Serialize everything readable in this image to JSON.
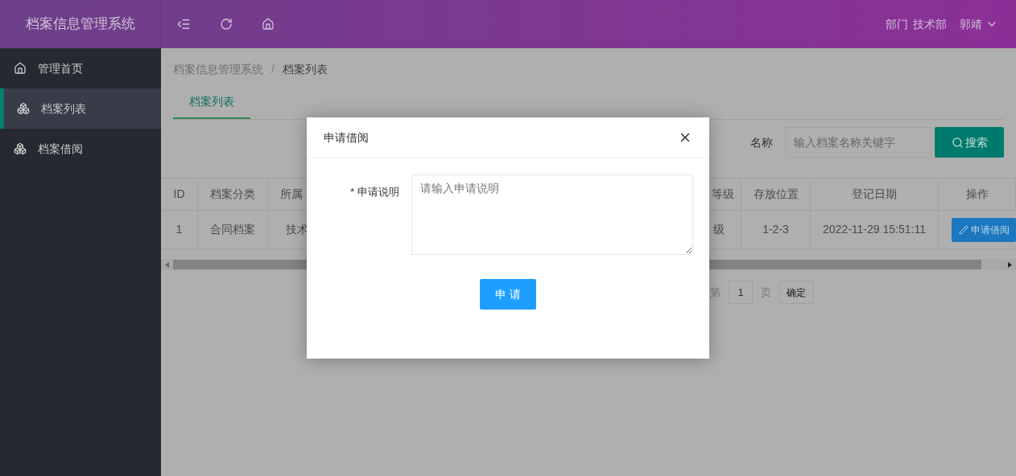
{
  "header": {
    "title": "档案信息管理系统",
    "dept_label": "部门",
    "dept": "技术部",
    "user": "郭靖"
  },
  "sidebar": {
    "items": [
      {
        "label": "管理首页",
        "kind": "home",
        "selected": false
      },
      {
        "label": "档案列表",
        "kind": "boxes",
        "selected": true
      },
      {
        "label": "档案借阅",
        "kind": "boxes",
        "selected": false
      }
    ]
  },
  "breadcrumb": {
    "items": [
      "档案信息管理系统",
      "档案列表"
    ],
    "separator": "/"
  },
  "tabs": [
    {
      "label": "档案列表",
      "selected": true
    }
  ],
  "search": {
    "label": "名称",
    "placeholder": "输入档案名称关键字",
    "button": "搜索"
  },
  "table": {
    "columns": [
      "ID",
      "档案分类",
      "所属",
      "等级",
      "存放位置",
      "登记日期",
      "操作"
    ],
    "rows": [
      {
        "cells": [
          "1",
          "合同档案",
          "技术",
          "级",
          "1-2-3",
          "2022-11-29 15:51:11"
        ],
        "action": "申请借阅"
      }
    ]
  },
  "pagination": {
    "prefix": "第",
    "page": "1",
    "suffix": "页",
    "button": "确定"
  },
  "dialog": {
    "title": "申请借阅",
    "field_label": "申请说明",
    "required_mark": "*",
    "placeholder": "请输入申请说明",
    "submit": "申 请"
  }
}
